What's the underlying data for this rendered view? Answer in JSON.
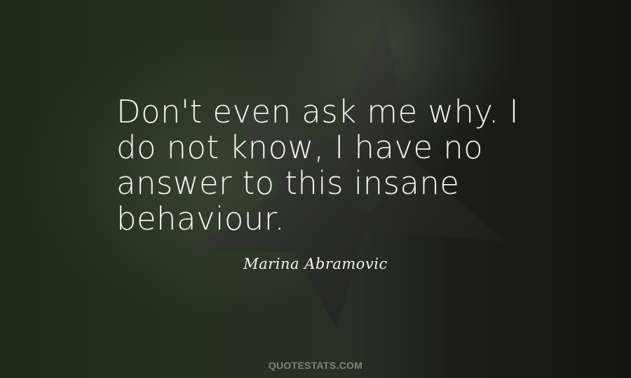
{
  "quote": {
    "lines": [
      "Don't even ask me why. I",
      "do not know, I have no",
      "answer to this insane",
      "behaviour."
    ]
  },
  "author": "Marina Abramovic",
  "watermark": "QUOTESTATS.COM",
  "colors": {
    "background": "#1a1f17",
    "quote_text": "#f2f2ef",
    "author_text": "#f5f5f0",
    "watermark_text": "#7f8478"
  }
}
